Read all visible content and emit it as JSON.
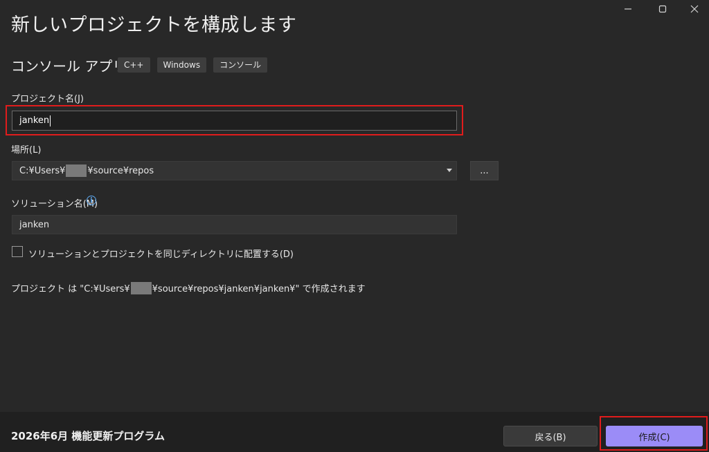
{
  "window": {
    "title": "新しいプロジェクトを構成します",
    "controls": {
      "minimize": "minimize-icon",
      "maximize": "maximize-icon",
      "close": "close-icon"
    }
  },
  "template": {
    "name": "コンソール アプリ",
    "tags": [
      "C++",
      "Windows",
      "コンソール"
    ]
  },
  "project_name": {
    "label": "プロジェクト名(J)",
    "value": "janken"
  },
  "location": {
    "label": "場所(L)",
    "value_prefix": "C:¥Users¥",
    "value_suffix": "¥source¥repos",
    "browse_label": "..."
  },
  "solution_name": {
    "label": "ソリューション名(M)",
    "value": "janken",
    "info_icon": "i"
  },
  "same_dir_checkbox": {
    "label": "ソリューションとプロジェクトを同じディレクトリに配置する(D)",
    "checked": false
  },
  "path_note": {
    "prefix": "プロジェクト は \"C:¥Users¥",
    "suffix": "¥source¥repos¥janken¥janken¥\" で作成されます"
  },
  "footer": {
    "version_text": "2026年6月 機能更新プログラム",
    "back_label": "戻る(B)",
    "create_label": "作成(C)"
  },
  "colors": {
    "background": "#282828",
    "accent_button": "#9b8cf7",
    "highlight_box": "#e11c1c",
    "info": "#5ea9f0"
  }
}
